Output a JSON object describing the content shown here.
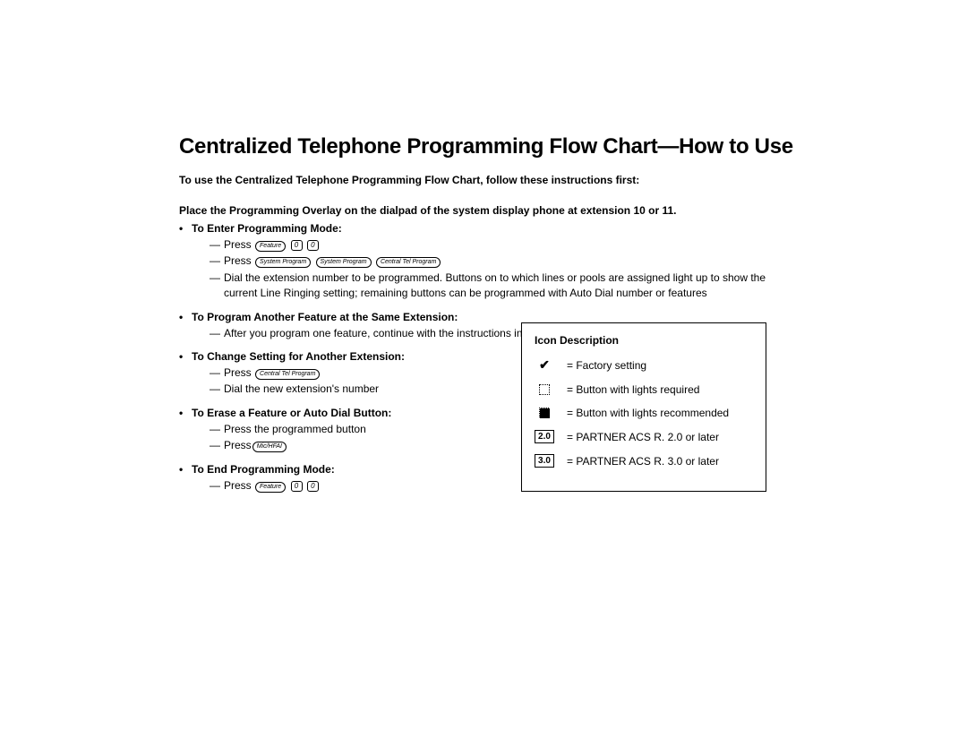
{
  "title": "Centralized Telephone Programming Flow Chart—How to Use",
  "intro": "To use the Centralized Telephone Programming Flow Chart, follow these instructions first:",
  "overlay": "Place the Programming Overlay on the dialpad of the system display phone at extension 10 or 11.",
  "sections": {
    "enter": {
      "heading": "To Enter Programming Mode:",
      "press_word": "Press",
      "keys1": {
        "feature": "Feature",
        "d1": "0",
        "d2": "0"
      },
      "keys2": {
        "sp1": "System Program",
        "sp2": "System Program",
        "ctp": "Central Tel Program"
      },
      "dial": "Dial the extension number to be programmed. Buttons on to which lines or pools are assigned light up to show the current Line Ringing setting; remaining buttons can be programmed with Auto Dial number or features"
    },
    "another_feature": {
      "heading": "To Program Another Feature at the Same Extension:",
      "line": "After you program one feature, continue with the instructions in the box for the next feature"
    },
    "change_ext": {
      "heading": "To Change Setting for Another Extension:",
      "press_word": "Press",
      "ctp": "Central Tel Program",
      "dial": "Dial the new extension's number"
    },
    "erase": {
      "heading": "To Erase a Feature or Auto Dial Button:",
      "press_btn": "Press the programmed button",
      "press_word": "Press",
      "mic": "Mic/HFAI"
    },
    "end": {
      "heading": "To End Programming Mode:",
      "press_word": "Press",
      "feature": "Feature",
      "d1": "0",
      "d2": "0"
    }
  },
  "iconbox": {
    "title": "Icon Description",
    "rows": {
      "factory": "= Factory setting",
      "lights_req": "= Button with lights required",
      "lights_rec": "= Button with lights recommended",
      "v20_label": "2.0",
      "v20_text": "= PARTNER ACS R. 2.0 or later",
      "v30_label": "3.0",
      "v30_text": "= PARTNER ACS R. 3.0 or later"
    }
  }
}
